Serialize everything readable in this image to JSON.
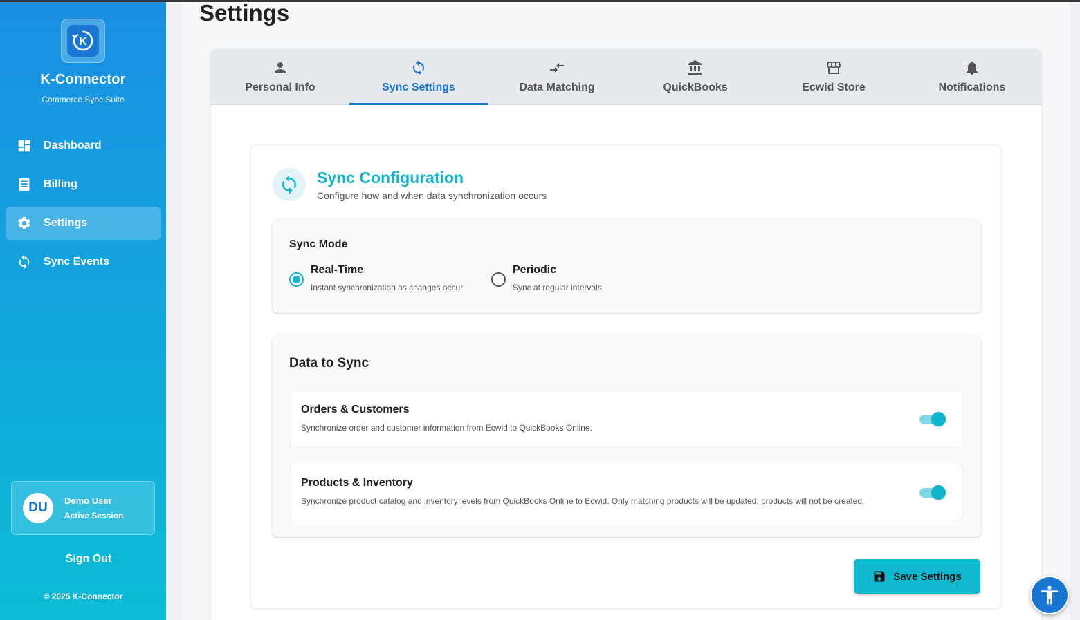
{
  "app": {
    "name": "K-Connector",
    "tagline": "Commerce Sync Suite",
    "logo_letter": "K"
  },
  "sidebar": {
    "items": [
      {
        "label": "Dashboard",
        "icon": "dashboard-icon",
        "active": false
      },
      {
        "label": "Billing",
        "icon": "receipt-icon",
        "active": false
      },
      {
        "label": "Settings",
        "icon": "gear-icon",
        "active": true
      },
      {
        "label": "Sync Events",
        "icon": "sync-icon",
        "active": false
      }
    ],
    "user": {
      "initials": "DU",
      "name": "Demo User",
      "status": "Active Session"
    },
    "sign_out": "Sign Out",
    "copyright": "© 2025 K-Connector"
  },
  "page": {
    "title": "Settings"
  },
  "tabs": [
    {
      "label": "Personal Info",
      "icon": "person-icon",
      "active": false
    },
    {
      "label": "Sync Settings",
      "icon": "sync-icon",
      "active": true
    },
    {
      "label": "Data Matching",
      "icon": "compare-arrows-icon",
      "active": false
    },
    {
      "label": "QuickBooks",
      "icon": "bank-icon",
      "active": false
    },
    {
      "label": "Ecwid Store",
      "icon": "store-icon",
      "active": false
    },
    {
      "label": "Notifications",
      "icon": "bell-icon",
      "active": false
    }
  ],
  "sync_config": {
    "title": "Sync Configuration",
    "subtitle": "Configure how and when data synchronization occurs",
    "sync_mode": {
      "title": "Sync Mode",
      "options": [
        {
          "label": "Real-Time",
          "description": "Instant synchronization as changes occur",
          "selected": true
        },
        {
          "label": "Periodic",
          "description": "Sync at regular intervals",
          "selected": false
        }
      ]
    },
    "data_to_sync": {
      "title": "Data to Sync",
      "items": [
        {
          "title": "Orders & Customers",
          "description": "Synchronize order and customer information from Ecwid to QuickBooks Online.",
          "enabled": true
        },
        {
          "title": "Products & Inventory",
          "description": "Synchronize product catalog and inventory levels from QuickBooks Online to Ecwid. Only matching products will be updated; products will not be created.",
          "enabled": true
        }
      ]
    },
    "save_label": "Save Settings"
  },
  "colors": {
    "primary": "#1976d2",
    "accent": "#10b4cc"
  }
}
